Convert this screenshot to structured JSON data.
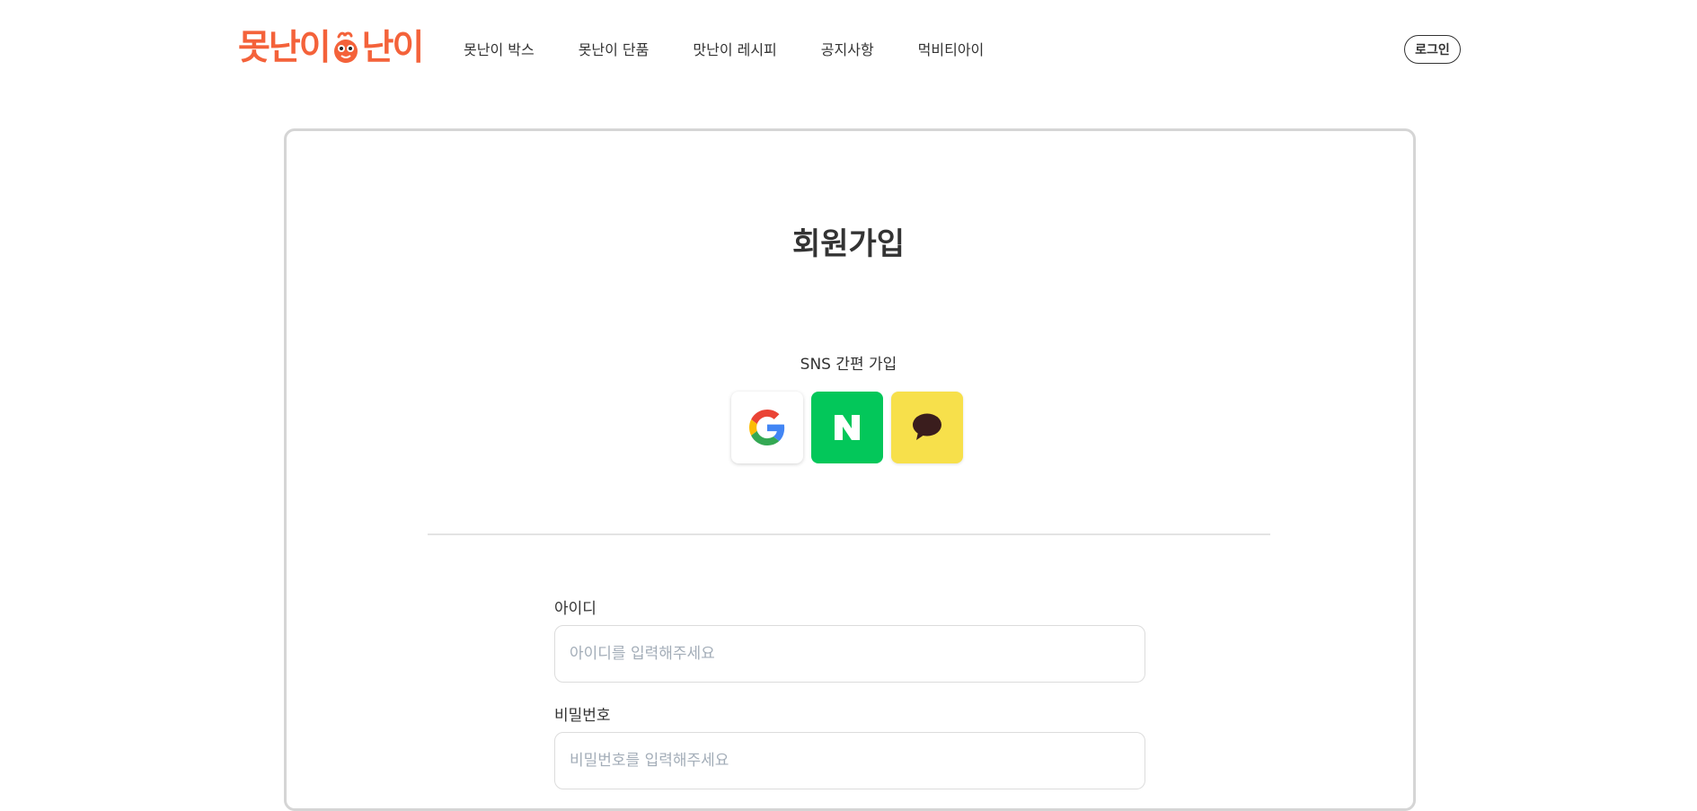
{
  "header": {
    "logo": {
      "part1": "못난이",
      "part2": "난이"
    },
    "nav": [
      "못난이 박스",
      "못난이 단품",
      "맛난이 레시피",
      "공지사항",
      "먹비티아이"
    ],
    "login_label": "로그인"
  },
  "signup": {
    "title": "회원가입",
    "sns_label": "SNS 간편 가입",
    "sns": [
      {
        "provider": "google",
        "icon": "google-icon"
      },
      {
        "provider": "naver",
        "icon": "naver-icon",
        "color": "#03c75a"
      },
      {
        "provider": "kakao",
        "icon": "kakao-icon",
        "color": "#f7e04b"
      }
    ],
    "fields": [
      {
        "label": "아이디",
        "placeholder": "아이디를 입력해주세요",
        "value": ""
      },
      {
        "label": "비밀번호",
        "placeholder": "비밀번호를 입력해주세요",
        "value": ""
      }
    ]
  },
  "colors": {
    "brand": "#f4623a",
    "naver": "#03c75a",
    "kakao": "#f7e04b",
    "card_border": "#d5d5d5"
  }
}
